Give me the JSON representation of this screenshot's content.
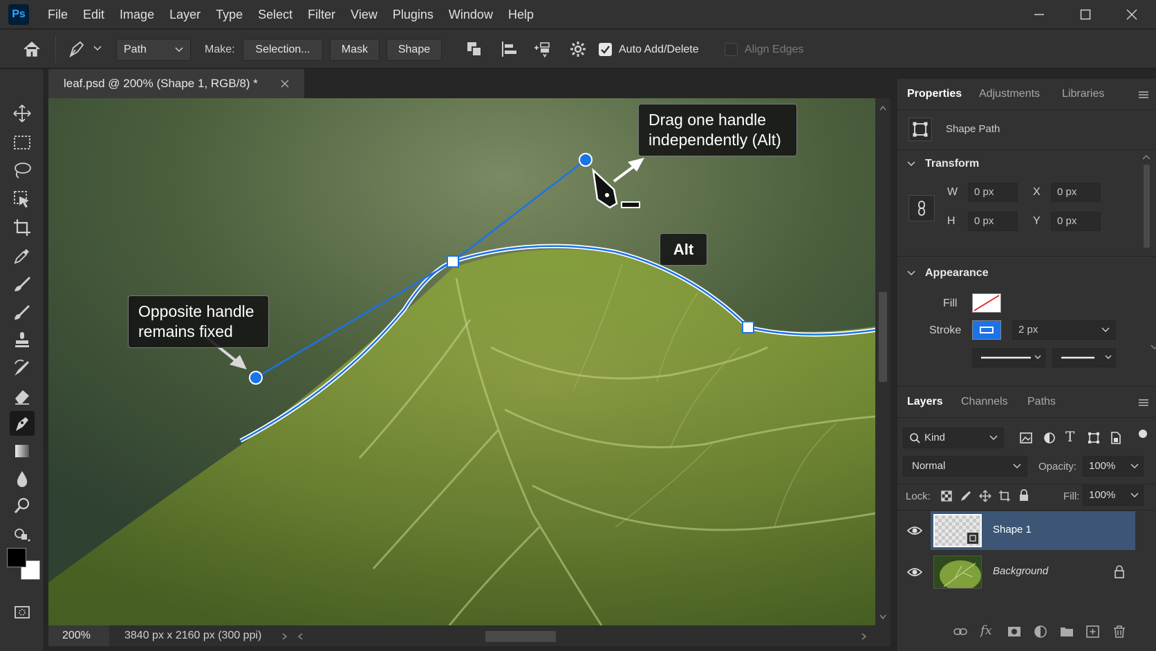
{
  "app": {
    "logo": "Ps"
  },
  "menu": [
    "File",
    "Edit",
    "Image",
    "Layer",
    "Type",
    "Select",
    "Filter",
    "View",
    "Plugins",
    "Window",
    "Help"
  ],
  "options_bar": {
    "mode": "Path",
    "make_label": "Make:",
    "selection_btn": "Selection...",
    "mask_btn": "Mask",
    "shape_btn": "Shape",
    "auto_add_delete": "Auto Add/Delete",
    "auto_add_delete_checked": true,
    "align_edges": "Align Edges",
    "align_edges_checked": false
  },
  "document": {
    "tab_title": "leaf.psd @ 200% (Shape 1, RGB/8) *",
    "zoom": "200%",
    "info": "3840 px x 2160 px (300 ppi)"
  },
  "callouts": {
    "drag": "Drag one handle independently (Alt)",
    "opposite": "Opposite handle remains fixed",
    "alt_key": "Alt"
  },
  "properties": {
    "tabs": [
      "Properties",
      "Adjustments",
      "Libraries"
    ],
    "kind": "Shape Path",
    "transform": {
      "title": "Transform",
      "w_label": "W",
      "w": "0 px",
      "h_label": "H",
      "h": "0 px",
      "x_label": "X",
      "x": "0 px",
      "y_label": "Y",
      "y": "0 px"
    },
    "appearance": {
      "title": "Appearance",
      "fill_label": "Fill",
      "stroke_label": "Stroke",
      "stroke_width": "2 px",
      "stroke_color": "#1a73e8"
    }
  },
  "layers": {
    "tabs": [
      "Layers",
      "Channels",
      "Paths"
    ],
    "kind_filter": "Kind",
    "blend_mode": "Normal",
    "opacity_label": "Opacity:",
    "opacity": "100%",
    "lock_label": "Lock:",
    "fill_label": "Fill:",
    "fill": "100%",
    "items": [
      {
        "name": "Shape 1",
        "selected": true
      },
      {
        "name": "Background",
        "selected": false,
        "locked": true
      }
    ]
  },
  "colors": {
    "accent": "#1a73e8",
    "selected_layer": "#3d5675"
  }
}
